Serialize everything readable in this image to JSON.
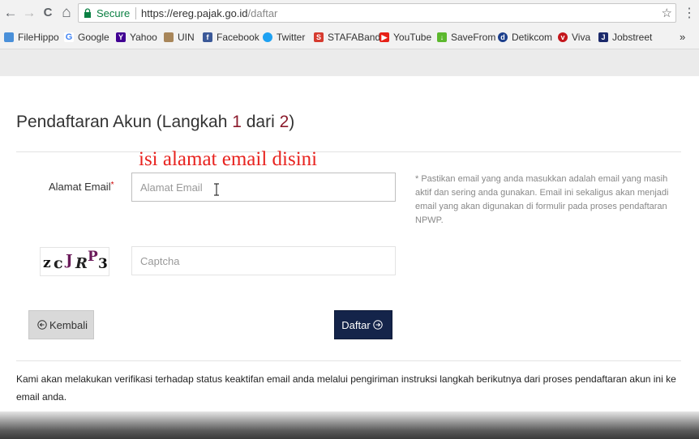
{
  "browser": {
    "secure_label": "Secure",
    "url_host": "https://ereg.pajak.go.id",
    "url_path": "/daftar",
    "nav": {
      "back": "←",
      "forward": "→",
      "reload": "C",
      "home": "⌂",
      "star": "☆",
      "menu": "⋮"
    }
  },
  "bookmarks": {
    "items": [
      {
        "label": "FileHippo",
        "icon": "filehippo-icon",
        "color": "#4a90d9"
      },
      {
        "label": "Google",
        "icon": "google-icon",
        "color": "#4285f4"
      },
      {
        "label": "Yahoo",
        "icon": "yahoo-icon",
        "color": "#410093"
      },
      {
        "label": "UIN",
        "icon": "uin-icon",
        "color": "#a8865a"
      },
      {
        "label": "Facebook",
        "icon": "facebook-icon",
        "color": "#3b5998"
      },
      {
        "label": "Twitter",
        "icon": "twitter-icon",
        "color": "#1da1f2"
      },
      {
        "label": "STAFABand",
        "icon": "stafaband-icon",
        "color": "#d63b2f"
      },
      {
        "label": "YouTube",
        "icon": "youtube-icon",
        "color": "#e62117"
      },
      {
        "label": "SaveFrom",
        "icon": "savefrom-icon",
        "color": "#5cb82e"
      },
      {
        "label": "Detikcom",
        "icon": "detikcom-icon",
        "color": "#1c3f8c"
      },
      {
        "label": "Viva",
        "icon": "viva-icon",
        "color": "#c4161c"
      },
      {
        "label": "Jobstreet",
        "icon": "jobstreet-icon",
        "color": "#1c2a6b"
      }
    ],
    "more": "»"
  },
  "form": {
    "title_prefix": "Pendaftaran Akun  (Langkah ",
    "step_current": "1",
    "title_middle": " dari ",
    "step_total": "2",
    "title_suffix": ")",
    "annotation": "isi alamat email disini",
    "email_label": "Alamat Email",
    "required_mark": "*",
    "email_placeholder": "Alamat Email",
    "hint": "* Pastikan email yang anda masukkan adalah email yang masih aktif dan sering anda gunakan. Email ini sekaligus akan menjadi email yang akan digunakan di formulir pada proses pendaftaran NPWP.",
    "captcha_text": "zcJRP3",
    "captcha_placeholder": "Captcha",
    "back_label": "Kembali",
    "submit_label": "Daftar",
    "footnote": "Kami akan melakukan verifikasi terhadap status keaktifan email anda melalui pengiriman instruksi langkah berikutnya dari proses pendaftaran akun ini ke email anda."
  },
  "colors": {
    "accent_dark": "#14244a",
    "step_number": "#8b1a2b",
    "annotation": "#e8231f",
    "secure_green": "#0b8043"
  }
}
